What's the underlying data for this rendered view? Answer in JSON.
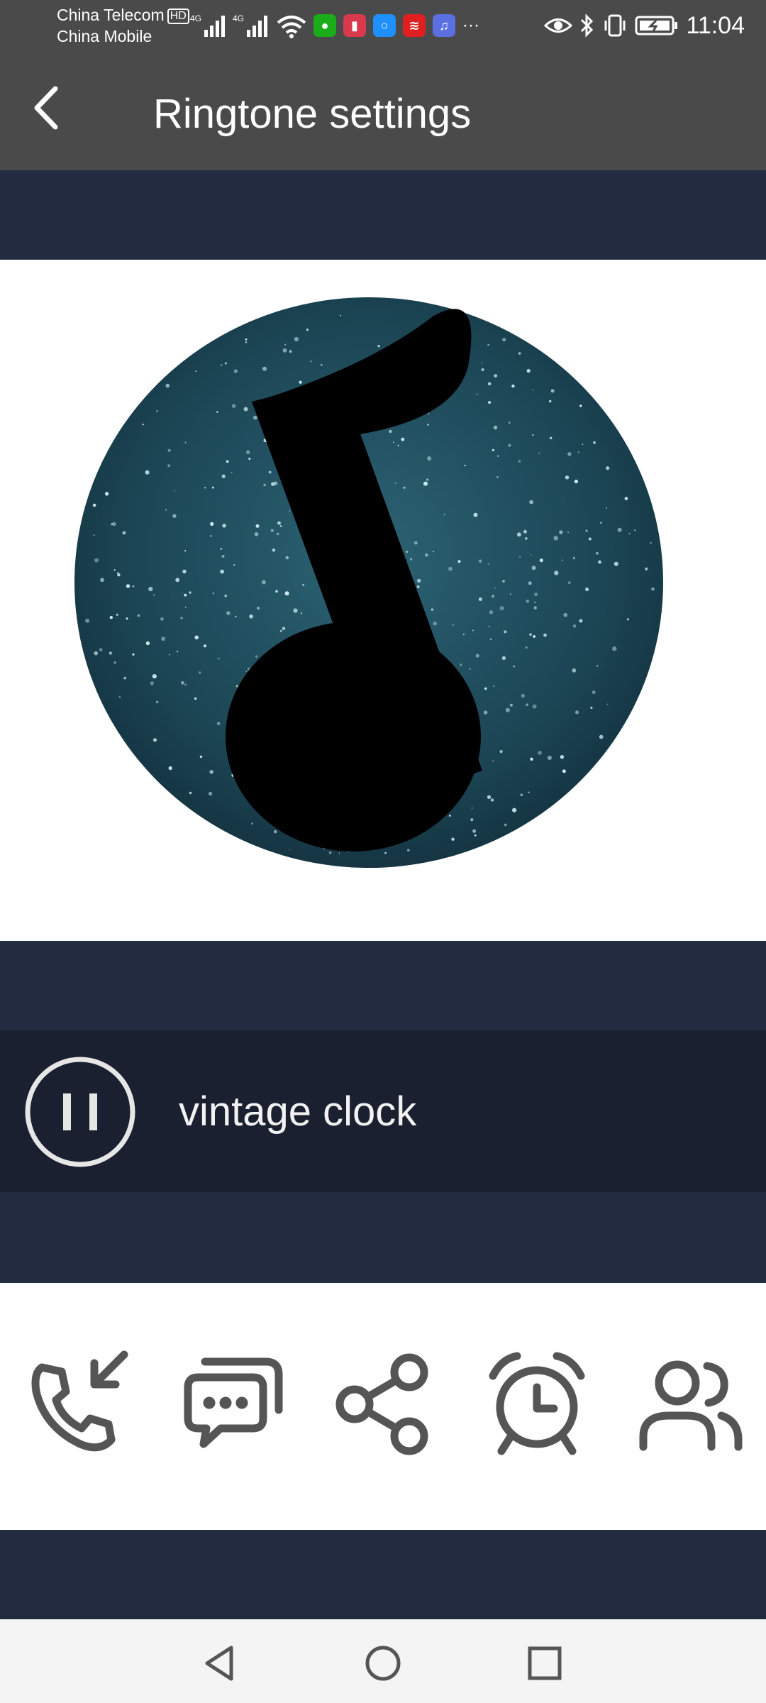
{
  "status_bar": {
    "carrier_1": "China Telecom",
    "carrier_1_badge": "HD",
    "carrier_2": "China Mobile",
    "network_1": "4G",
    "network_2": "4G",
    "more_indicator": "···",
    "time": "11:04",
    "notification_icons": [
      "wechat-icon",
      "reader-icon",
      "search-app-icon",
      "news-app-icon",
      "music-app-icon"
    ]
  },
  "header": {
    "title": "Ringtone settings",
    "back_icon": "chevron-left-icon"
  },
  "artwork": {
    "icon": "music-note-icon",
    "style": "glitter circle"
  },
  "player": {
    "state_icon": "pause-icon",
    "track_name": "vintage clock"
  },
  "actions": [
    {
      "name": "set-call-ringtone",
      "icon": "incoming-call-icon"
    },
    {
      "name": "set-message-tone",
      "icon": "chat-bubbles-icon"
    },
    {
      "name": "share",
      "icon": "share-icon"
    },
    {
      "name": "set-alarm",
      "icon": "alarm-clock-icon"
    },
    {
      "name": "set-contact-ringtone",
      "icon": "contacts-icon"
    }
  ],
  "colors": {
    "status_header_bg": "#4a4a4a",
    "page_bg": "#222b3f",
    "player_bg": "#1a2030",
    "panel_bg": "#ffffff",
    "icon_gray": "#555555",
    "glitter_teal": "#1d4654"
  },
  "nav_bar": {
    "back": "triangle-back-icon",
    "home": "circle-home-icon",
    "recents": "square-recents-icon"
  }
}
